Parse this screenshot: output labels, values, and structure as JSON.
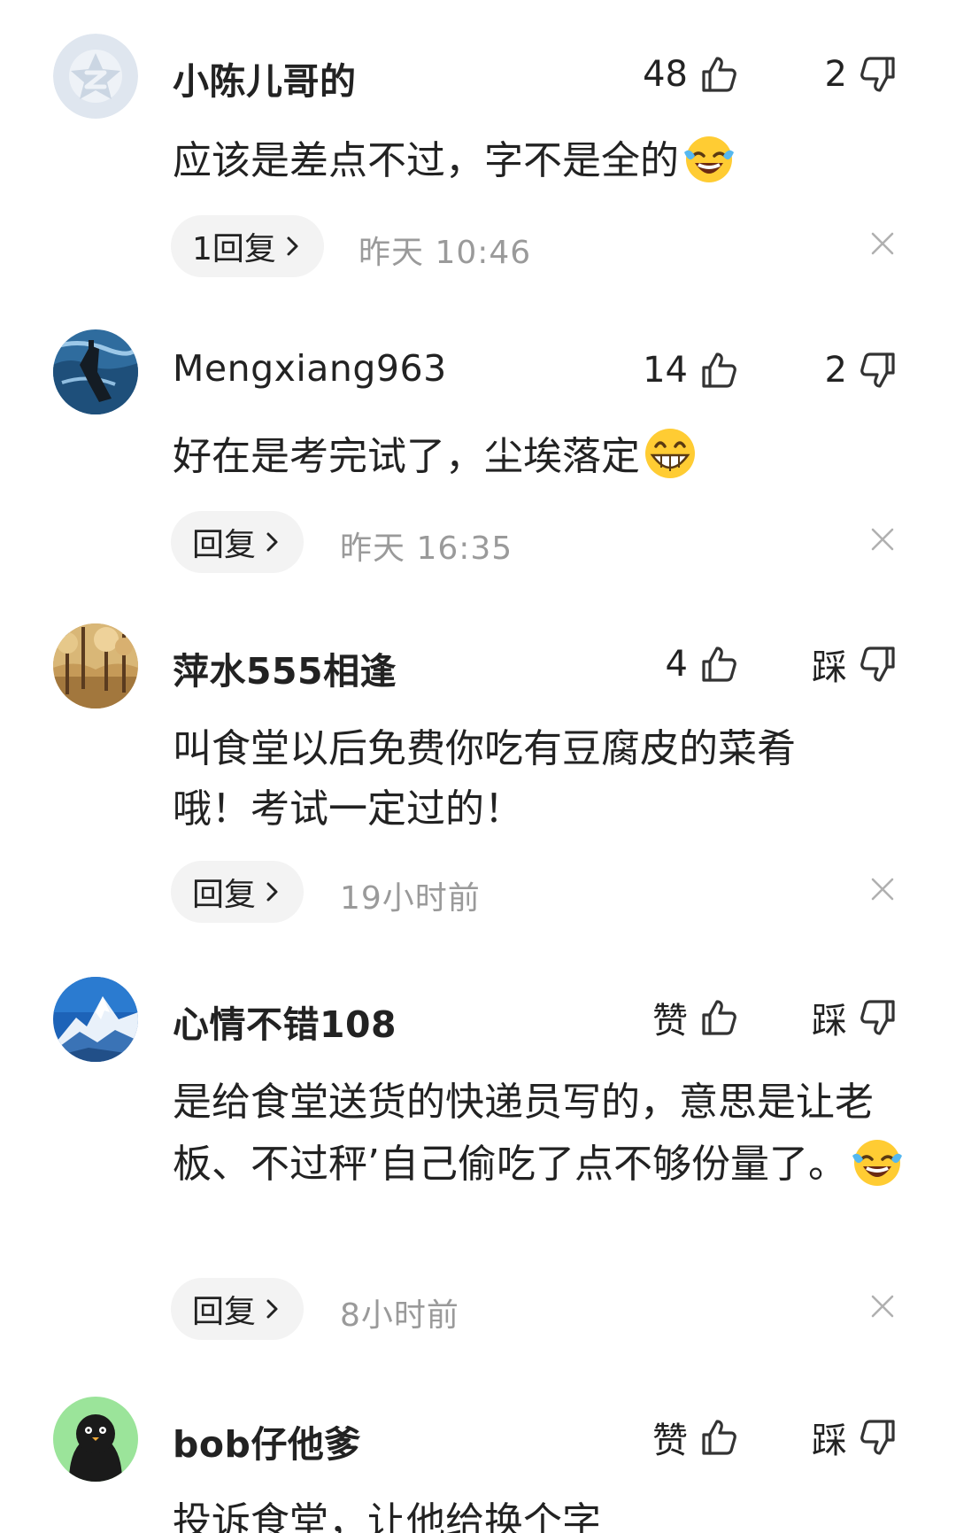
{
  "comments": [
    {
      "username": "小陈儿哥的",
      "avatar_icon": "qq-default-avatar-icon",
      "like_label": "48",
      "dislike_label": "2",
      "text": "应该是差点不过，字不是全的",
      "emoji": "laughing-crying-emoji",
      "reply_label": "1回复",
      "timestamp": "昨天  10:46"
    },
    {
      "username": "Mengxiang963",
      "avatar_icon": "submarine-ocean-avatar",
      "like_label": "14",
      "dislike_label": "2",
      "text": "好在是考完试了，尘埃落定",
      "emoji": "grinning-emoji",
      "reply_label": "回复",
      "timestamp": "昨天  16:35"
    },
    {
      "username": "萍水555相逢",
      "avatar_icon": "autumn-forest-avatar",
      "like_label": "4",
      "dislike_label": "踩",
      "text": "叫食堂以后免费你吃有豆腐皮的菜肴哦！考试一定过的！",
      "emoji": "",
      "reply_label": "回复",
      "timestamp": "19小时前"
    },
    {
      "username": "心情不错108",
      "avatar_icon": "snow-mountain-avatar",
      "like_label": "赞",
      "dislike_label": "踩",
      "text": "是给食堂送货的快递员写的，意思是让老板、不过秤’自己偷吃了点不够份量了。",
      "emoji": "laughing-crying-emoji",
      "reply_label": "回复",
      "timestamp": "8小时前"
    },
    {
      "username": "bob仔他爹",
      "avatar_icon": "black-bird-avatar",
      "like_label": "赞",
      "dislike_label": "踩",
      "text": "投诉食堂，让他给换个字"
    }
  ],
  "colors": {
    "text": "#222222",
    "muted": "#9a9a9a",
    "pill_bg": "#f3f3f3",
    "icon": "#333333"
  }
}
